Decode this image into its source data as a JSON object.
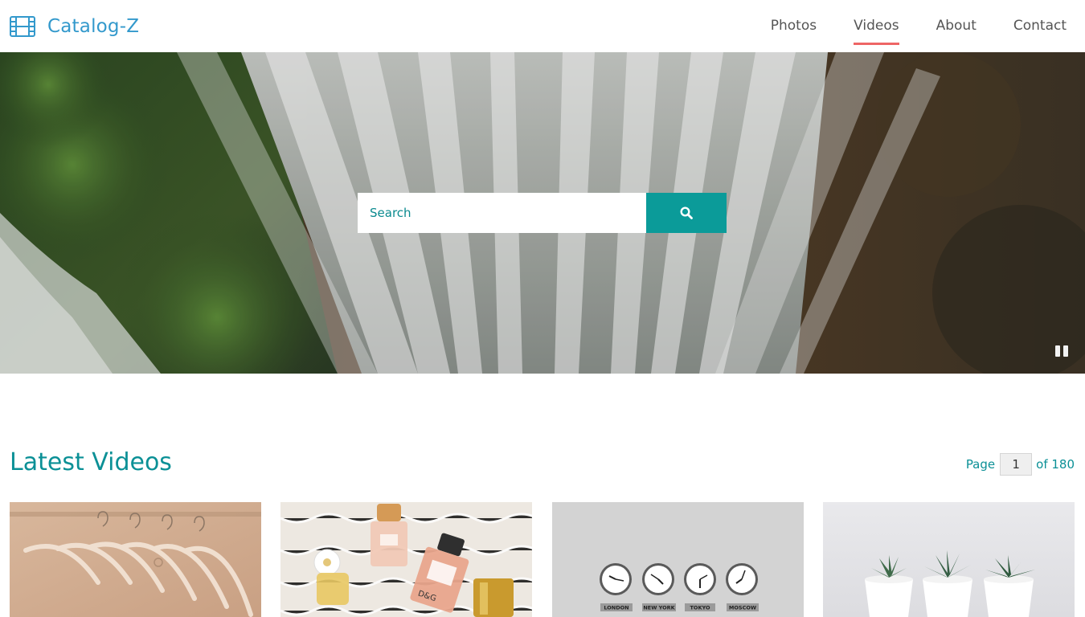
{
  "brand": {
    "name": "Catalog-Z",
    "icon": "film-icon"
  },
  "nav": {
    "items": [
      {
        "label": "Photos",
        "active": false
      },
      {
        "label": "Videos",
        "active": true
      },
      {
        "label": "About",
        "active": false
      },
      {
        "label": "Contact",
        "active": false
      }
    ]
  },
  "hero": {
    "search_placeholder": "Search",
    "search_icon": "search-icon",
    "pause_icon": "pause-icon"
  },
  "section": {
    "title": "Latest Videos"
  },
  "pagination": {
    "prefix": "Page",
    "current": "1",
    "suffix": "of 180"
  },
  "clocks": [
    "LONDON",
    "NEW YORK",
    "TOKYO",
    "MOSCOW"
  ],
  "perfume": {
    "label": "D&G"
  },
  "colors": {
    "brand": "#3399cc",
    "accent": "#0b9b99",
    "nav_active_underline": "#ee6666",
    "heading": "#0b9096"
  }
}
